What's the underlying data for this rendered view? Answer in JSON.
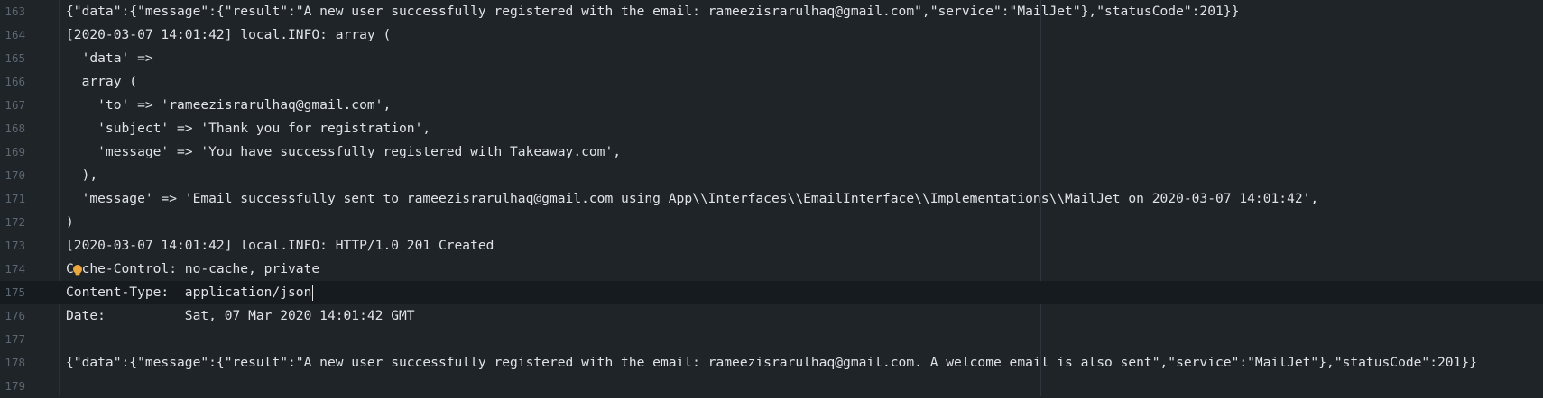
{
  "editor": {
    "lines": [
      {
        "num": "163",
        "text": "{\"data\":{\"message\":{\"result\":\"A new user successfully registered with the email: rameezisrarulhaq@gmail.com\",\"service\":\"MailJet\"},\"statusCode\":201}}"
      },
      {
        "num": "164",
        "text": "[2020-03-07 14:01:42] local.INFO: array ("
      },
      {
        "num": "165",
        "text": "  'data' =>"
      },
      {
        "num": "166",
        "text": "  array ("
      },
      {
        "num": "167",
        "text": "    'to' => 'rameezisrarulhaq@gmail.com',"
      },
      {
        "num": "168",
        "text": "    'subject' => 'Thank you for registration',"
      },
      {
        "num": "169",
        "text": "    'message' => 'You have successfully registered with Takeaway.com',"
      },
      {
        "num": "170",
        "text": "  ),"
      },
      {
        "num": "171",
        "text": "  'message' => 'Email successfully sent to rameezisrarulhaq@gmail.com using App\\\\Interfaces\\\\EmailInterface\\\\Implementations\\\\MailJet on 2020-03-07 14:01:42',"
      },
      {
        "num": "172",
        "text": ")"
      },
      {
        "num": "173",
        "text": "[2020-03-07 14:01:42] local.INFO: HTTP/1.0 201 Created"
      },
      {
        "num": "174",
        "text": "Cache-Control: no-cache, private"
      },
      {
        "num": "175",
        "text": "Content-Type:  application/json"
      },
      {
        "num": "176",
        "text": "Date:          Sat, 07 Mar 2020 14:01:42 GMT"
      },
      {
        "num": "177",
        "text": ""
      },
      {
        "num": "178",
        "text": "{\"data\":{\"message\":{\"result\":\"A new user successfully registered with the email: rameezisrarulhaq@gmail.com. A welcome email is also sent\",\"service\":\"MailJet\"},\"statusCode\":201}}"
      },
      {
        "num": "179",
        "text": ""
      }
    ],
    "active_line_index": 12
  },
  "colors": {
    "background": "#1f2428",
    "active_line": "#161b1f",
    "text": "#dfe3e7",
    "line_number": "#5c6670",
    "bulb": "#f0a73a"
  },
  "icons": {
    "intention": "lightbulb-icon"
  }
}
